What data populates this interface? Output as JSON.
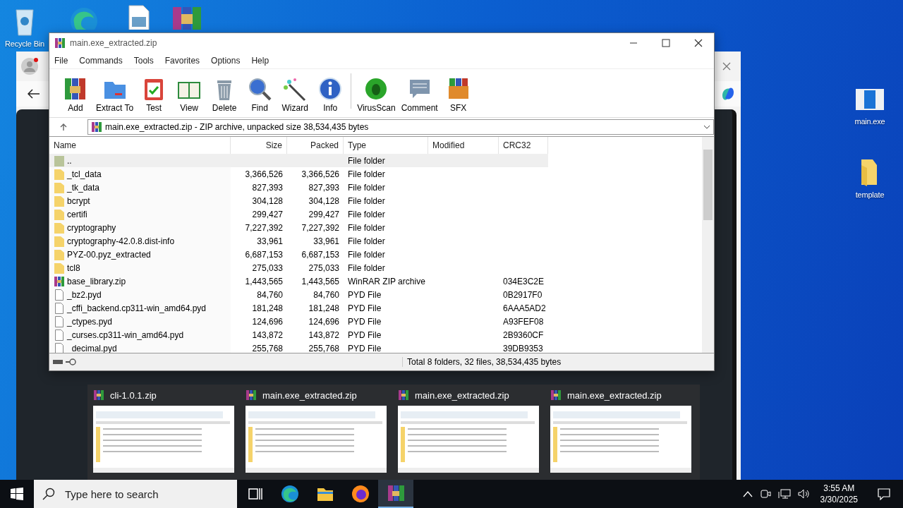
{
  "desktop_icons": [
    {
      "kind": "recycle-bin",
      "label": "Recycle Bin"
    },
    {
      "kind": "browser"
    },
    {
      "kind": "image-file"
    },
    {
      "kind": "archive"
    },
    {
      "kind": "app",
      "label": "main.exe"
    },
    {
      "kind": "folder",
      "label": "template"
    }
  ],
  "window": {
    "title": "main.exe_extracted.zip",
    "menu": [
      "File",
      "Commands",
      "Tools",
      "Favorites",
      "Options",
      "Help"
    ],
    "toolbar": [
      {
        "kind": "add",
        "label": "Add"
      },
      {
        "kind": "extract",
        "label": "Extract To"
      },
      {
        "kind": "test",
        "label": "Test"
      },
      {
        "kind": "view",
        "label": "View"
      },
      {
        "kind": "delete",
        "label": "Delete"
      },
      {
        "kind": "find",
        "label": "Find"
      },
      {
        "kind": "wizard",
        "label": "Wizard"
      },
      {
        "kind": "info",
        "label": "Info"
      },
      {
        "kind": "virusscan",
        "label": "VirusScan"
      },
      {
        "kind": "comment",
        "label": "Comment"
      },
      {
        "kind": "sfx",
        "label": "SFX"
      }
    ],
    "address": "main.exe_extracted.zip - ZIP archive, unpacked size 38,534,435 bytes",
    "columns": [
      "Name",
      "Size",
      "Packed",
      "Type",
      "Modified",
      "CRC32"
    ],
    "rows": [
      {
        "kind": "parent",
        "name": "..",
        "size": "",
        "packed": "",
        "type": "File folder",
        "crc": "",
        "selected": true
      },
      {
        "kind": "folder",
        "name": "_tcl_data",
        "size": "3,366,526",
        "packed": "3,366,526",
        "type": "File folder",
        "crc": "",
        "selected": false
      },
      {
        "kind": "folder",
        "name": "_tk_data",
        "size": "827,393",
        "packed": "827,393",
        "type": "File folder",
        "crc": "",
        "selected": false
      },
      {
        "kind": "folder",
        "name": "bcrypt",
        "size": "304,128",
        "packed": "304,128",
        "type": "File folder",
        "crc": "",
        "selected": false
      },
      {
        "kind": "folder",
        "name": "certifi",
        "size": "299,427",
        "packed": "299,427",
        "type": "File folder",
        "crc": "",
        "selected": false
      },
      {
        "kind": "folder",
        "name": "cryptography",
        "size": "7,227,392",
        "packed": "7,227,392",
        "type": "File folder",
        "crc": "",
        "selected": false
      },
      {
        "kind": "folder",
        "name": "cryptography-42.0.8.dist-info",
        "size": "33,961",
        "packed": "33,961",
        "type": "File folder",
        "crc": "",
        "selected": false
      },
      {
        "kind": "folder",
        "name": "PYZ-00.pyz_extracted",
        "size": "6,687,153",
        "packed": "6,687,153",
        "type": "File folder",
        "crc": "",
        "selected": false
      },
      {
        "kind": "folder",
        "name": "tcl8",
        "size": "275,033",
        "packed": "275,033",
        "type": "File folder",
        "crc": "",
        "selected": false
      },
      {
        "kind": "archive",
        "name": "base_library.zip",
        "size": "1,443,565",
        "packed": "1,443,565",
        "type": "WinRAR ZIP archive",
        "crc": "034E3C2E",
        "selected": false
      },
      {
        "kind": "file",
        "name": "_bz2.pyd",
        "size": "84,760",
        "packed": "84,760",
        "type": "PYD File",
        "crc": "0B2917F0",
        "selected": false
      },
      {
        "kind": "file",
        "name": "_cffi_backend.cp311-win_amd64.pyd",
        "size": "181,248",
        "packed": "181,248",
        "type": "PYD File",
        "crc": "6AAA5AD2",
        "selected": false
      },
      {
        "kind": "file",
        "name": "_ctypes.pyd",
        "size": "124,696",
        "packed": "124,696",
        "type": "PYD File",
        "crc": "A93FEF08",
        "selected": false
      },
      {
        "kind": "file",
        "name": "_curses.cp311-win_amd64.pyd",
        "size": "143,872",
        "packed": "143,872",
        "type": "PYD File",
        "crc": "2B9360CF",
        "selected": false
      },
      {
        "kind": "file",
        "name": "_decimal.pyd",
        "size": "255,768",
        "packed": "255,768",
        "type": "PYD File",
        "crc": "39DB9353",
        "selected": false
      }
    ],
    "status": "Total 8 folders, 32 files, 38,534,435 bytes"
  },
  "thumbnails": [
    {
      "title": "cli-1.0.1.zip"
    },
    {
      "title": "main.exe_extracted.zip"
    },
    {
      "title": "main.exe_extracted.zip"
    },
    {
      "title": "main.exe_extracted.zip"
    }
  ],
  "taskbar": {
    "search_placeholder": "Type here to search",
    "apps": [
      {
        "kind": "task-view",
        "active": false
      },
      {
        "kind": "edge",
        "active": false
      },
      {
        "kind": "explorer",
        "active": false
      },
      {
        "kind": "firefox",
        "active": false
      },
      {
        "kind": "winrar",
        "active": true
      }
    ],
    "time": "3:55 AM",
    "date": "3/30/2025"
  }
}
